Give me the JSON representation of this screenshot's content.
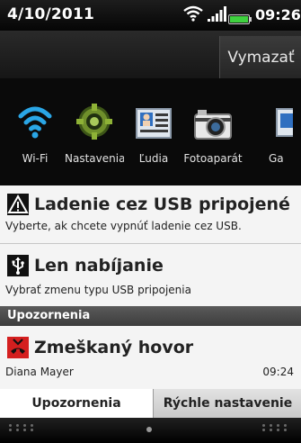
{
  "status_bar": {
    "date": "4/10/2011",
    "time": "09:26"
  },
  "clear_button": "Vymazať",
  "quick_settings": [
    {
      "label": "Wi-Fi",
      "icon": "wifi-icon"
    },
    {
      "label": "Nastavenia",
      "icon": "settings-gear-icon"
    },
    {
      "label": "Ľudia",
      "icon": "people-icon"
    },
    {
      "label": "Fotoaparát",
      "icon": "camera-icon"
    },
    {
      "label": "Ga",
      "icon": "gallery-icon"
    }
  ],
  "notifications": [
    {
      "title": "Ladenie cez USB pripojené",
      "subtitle": "Vyberte, ak chcete vypnúť ladenie cez USB.",
      "icon": "warning-icon"
    },
    {
      "title": "Len nabíjanie",
      "subtitle": "Vybrať zmenu typu USB pripojenia",
      "icon": "usb-icon"
    }
  ],
  "section_header": "Upozornenia",
  "missed_call": {
    "title": "Zmeškaný hovor",
    "caller": "Diana Mayer",
    "time": "09:24",
    "icon": "missed-call-icon"
  },
  "tabs": {
    "notifications": "Upozornenia",
    "quick_settings": "Rýchle nastavenie"
  },
  "colors": {
    "wifi_blue": "#2aa6e6",
    "missed_call_red": "#d41f1f",
    "battery_green": "#3fd13f"
  }
}
